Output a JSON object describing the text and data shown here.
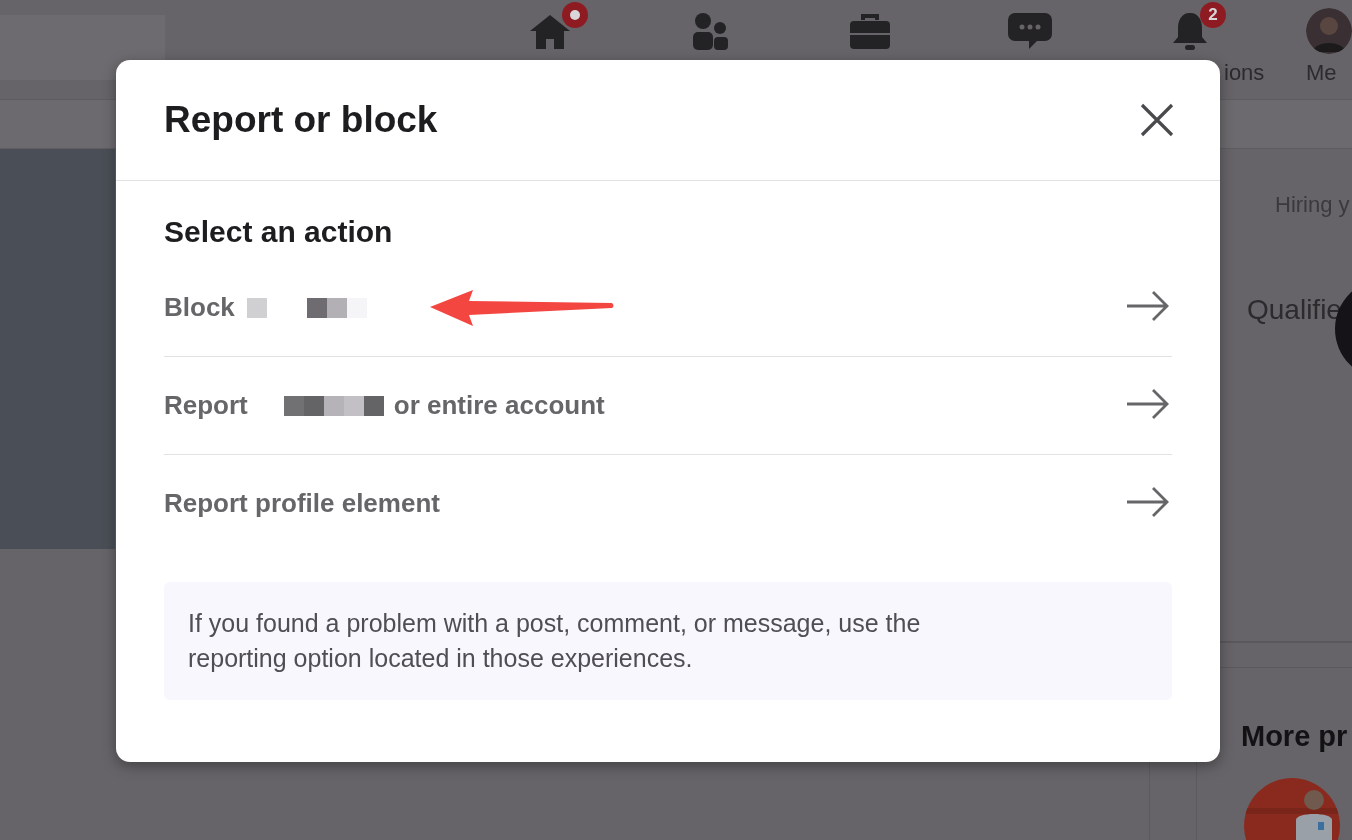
{
  "nav": {
    "items": [
      {
        "kind": "home",
        "badge": {
          "kind": "dot"
        }
      },
      {
        "kind": "people"
      },
      {
        "kind": "briefcase"
      },
      {
        "kind": "chat"
      },
      {
        "kind": "bell",
        "badge": {
          "kind": "count",
          "text": "2"
        },
        "label": "ions"
      },
      {
        "kind": "avatar",
        "label": "Me"
      }
    ]
  },
  "side_panel": {
    "hiring": "Hiring y",
    "qualified": "Qualifie",
    "more_heading": "More pr"
  },
  "dialog": {
    "title": "Report or block",
    "section_title": "Select an action",
    "actions": [
      {
        "label": "Block",
        "redacted": true,
        "annotated": true
      },
      {
        "label": "Report",
        "redacted": true,
        "suffix": "or entire account",
        "annotated": false
      },
      {
        "label": "Report profile element",
        "redacted": false,
        "annotated": false
      }
    ],
    "notice": "If you found a problem with a post, comment, or message, use the reporting option located in those experiences."
  }
}
